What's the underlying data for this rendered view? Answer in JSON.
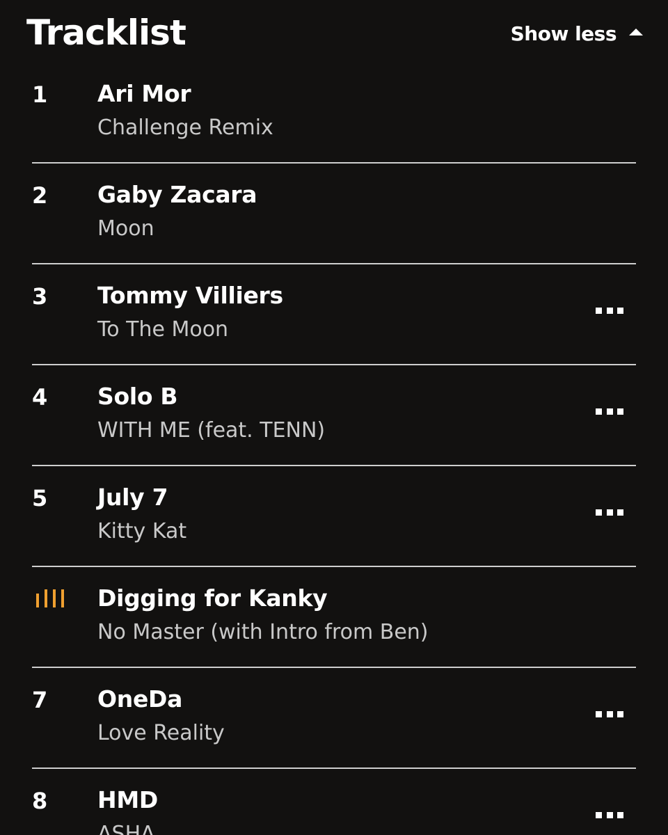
{
  "header": {
    "title": "Tracklist",
    "toggle_label": "Show less",
    "toggle_icon": "caret-up-icon"
  },
  "colors": {
    "background": "#121110",
    "accent": "#f0a030",
    "divider": "#cfcfcf",
    "secondary_text": "#c9c9c9"
  },
  "tracks": [
    {
      "number": "1",
      "artist": "Ari Mor",
      "title": "Challenge Remix",
      "has_menu": false,
      "playing": false
    },
    {
      "number": "2",
      "artist": "Gaby Zacara",
      "title": "Moon",
      "has_menu": false,
      "playing": false
    },
    {
      "number": "3",
      "artist": "Tommy Villiers",
      "title": "To The Moon",
      "has_menu": true,
      "playing": false
    },
    {
      "number": "4",
      "artist": "Solo B",
      "title": "WITH ME (feat. TENN)",
      "has_menu": true,
      "playing": false
    },
    {
      "number": "5",
      "artist": "July 7",
      "title": "Kitty Kat",
      "has_menu": true,
      "playing": false
    },
    {
      "number": "",
      "artist": "Digging for Kanky",
      "title": "No Master (with Intro from Ben)",
      "has_menu": false,
      "playing": true
    },
    {
      "number": "7",
      "artist": "OneDa",
      "title": "Love Reality",
      "has_menu": true,
      "playing": false
    },
    {
      "number": "8",
      "artist": "HMD",
      "title": "ASHA",
      "has_menu": true,
      "playing": false
    }
  ]
}
